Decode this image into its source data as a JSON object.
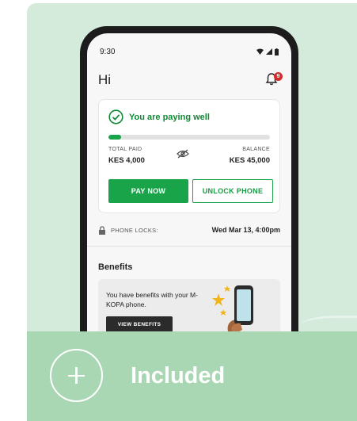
{
  "phone": {
    "status_time": "9:30",
    "greeting": "Hi",
    "notification_count": "9"
  },
  "payment": {
    "status_text": "You are paying well",
    "progress_fraction": 0.08,
    "total_paid_label": "TOTAL PAID",
    "total_paid_value": "KES 4,000",
    "balance_label": "BALANCE",
    "balance_value": "KES 45,000",
    "pay_button": "PAY NOW",
    "unlock_button": "UNLOCK PHONE"
  },
  "lock": {
    "label": "PHONE LOCKS:",
    "date": "Wed Mar 13, 4:00pm"
  },
  "benefits": {
    "title": "Benefits",
    "text": "You have benefits with your M-KOPA phone.",
    "button": "VIEW BENEFITS"
  },
  "feature": {
    "label": "Included"
  },
  "colors": {
    "brand_green": "#1aa449",
    "background_mint": "#d4ebdc",
    "bar_green": "#a9d6b3",
    "badge_red": "#d62b2b"
  }
}
